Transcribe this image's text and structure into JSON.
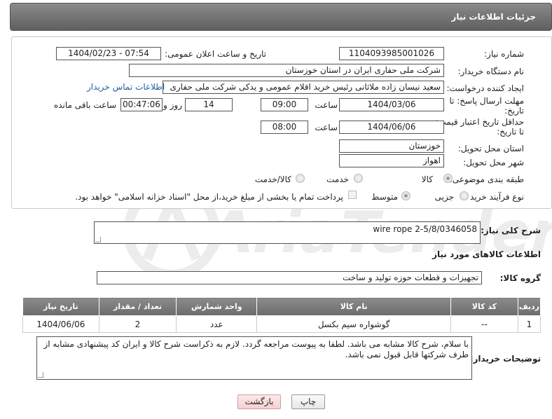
{
  "header": {
    "title": "جزئیات اطلاعات نیاز"
  },
  "form": {
    "need_number_label": "شماره نیاز:",
    "need_number": "1104093985001026",
    "announce_label": "تاریخ و ساعت اعلان عمومی:",
    "announce_value": "1404/02/23 - 07:54",
    "buyer_org_label": "نام دستگاه خریدار:",
    "buyer_org": "شرکت ملی حفاری ایران در استان خوزستان",
    "creator_label": "ایجاد کننده درخواست:",
    "creator": "سعید نیسان زاده ملاثانی رئیس خرید اقلام عمومی و یدکی شرکت ملی حفاری",
    "contact_link": "اطلاعات تماس خریدار",
    "deadline_label": "مهلت ارسال پاسخ: تا تاریخ:",
    "deadline_date": "1404/03/06",
    "time_label": "ساعت",
    "deadline_time": "09:00",
    "days_value": "14",
    "days_label": "روز و",
    "remaining_time": "00:47:06",
    "remaining_label": "ساعت باقی مانده",
    "validity_label": "حداقل تاریخ اعتبار قیمت: تا تاریخ:",
    "validity_date": "1404/06/06",
    "validity_time": "08:00",
    "province_label": "استان محل تحویل:",
    "province": "خوزستان",
    "city_label": "شهر محل تحویل:",
    "city": "اهواز",
    "category_label": "طبقه بندی موضوعی:",
    "category_options": [
      "کالا",
      "خدمت",
      "کالا/خدمت"
    ],
    "process_label": "نوع فرآیند خرید :",
    "process_options": [
      "جزیی",
      "متوسط"
    ],
    "payment_note": "پرداخت تمام یا بخشی از مبلغ خرید،از محل \"اسناد خزانه اسلامی\" خواهد بود."
  },
  "description": {
    "label": "شرح کلی نیاز:",
    "value": "wire rope 2-5/8/0346058"
  },
  "goods": {
    "section_title": "اطلاعات کالاهای مورد نیاز",
    "group_label": "گروه کالا:",
    "group_value": "تجهیزات و قطعات حوزه تولید و ساخت",
    "columns": [
      "ردیف",
      "کد کالا",
      "نام کالا",
      "واحد شمارش",
      "تعداد / مقدار",
      "تاریخ نیاز"
    ],
    "rows": [
      [
        "1",
        "--",
        "گوشواره سیم بکسل",
        "عدد",
        "2",
        "1404/06/06"
      ]
    ]
  },
  "buyer_notes": {
    "label": "توضیحات خریدار:",
    "value": "با سلام، شرح کالا مشابه می باشد. لطفا به پیوست مراجعه گردد. لازم به ذکراست شرح کالا و ایران کد  پیشنهادی مشابه از طرف شرکتها قابل قبول نمی باشد."
  },
  "buttons": {
    "print": "چاپ",
    "back": "بازگشت"
  },
  "colors": {
    "header_bg": "#6f6f6f",
    "link": "#1f5fa8",
    "back_button": "#f7cfd1"
  }
}
